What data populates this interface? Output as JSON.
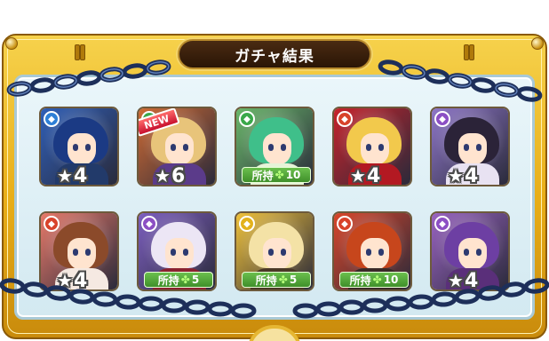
{
  "dialog": {
    "title": "ガチャ結果"
  },
  "colors": {
    "frame_gold": "#e8ad17",
    "panel_blue": "#d3e9f1",
    "title_plate": "#2a1506",
    "owned_green": "#4fa936",
    "chain_navy": "#1d2f5a"
  },
  "rows": [
    [
      {
        "element": "water",
        "element_icon": "water-icon",
        "rarity_value": "4",
        "is_new": false,
        "owned_label": "",
        "owned_count": "",
        "bg": "#2f5fb8",
        "hair": "#1b3a84",
        "outfit": "#223a6a"
      },
      {
        "element": "wood",
        "element_icon": "wood-icon",
        "rarity_value": "6",
        "is_new": true,
        "new_label": "NEW",
        "owned_label": "",
        "owned_count": "",
        "bg": "#cf6b34",
        "hair": "#e8c47a",
        "outfit": "#5b3b8a"
      },
      {
        "element": "wood",
        "element_icon": "wood-icon",
        "rarity_value": "",
        "is_new": false,
        "owned_label": "所持",
        "owned_count": "10",
        "bg": "#6ab86a",
        "hair": "#3fbf8a",
        "outfit": "#e6f3d8"
      },
      {
        "element": "fire",
        "element_icon": "fire-icon",
        "rarity_value": "4",
        "is_new": false,
        "owned_label": "",
        "owned_count": "",
        "bg": "#c8232b",
        "hair": "#f2c94c",
        "outfit": "#b31922"
      },
      {
        "element": "dark",
        "element_icon": "dark-icon",
        "rarity_value": "4",
        "is_new": false,
        "owned_label": "",
        "owned_count": "",
        "bg": "#8f77c9",
        "hair": "#2b2338",
        "outfit": "#e8e2f2"
      }
    ],
    [
      {
        "element": "fire",
        "element_icon": "fire-icon",
        "rarity_value": "4",
        "is_new": false,
        "owned_label": "",
        "owned_count": "",
        "bg": "#e87a6a",
        "hair": "#8b4a2a",
        "outfit": "#f5e9e2"
      },
      {
        "element": "dark",
        "element_icon": "dark-icon",
        "rarity_value": "",
        "is_new": false,
        "owned_label": "所持",
        "owned_count": "5",
        "bg": "#7d5fc0",
        "hair": "#ece6f5",
        "outfit": "#8a2230"
      },
      {
        "element": "light",
        "element_icon": "light-icon",
        "rarity_value": "",
        "is_new": false,
        "owned_label": "所持",
        "owned_count": "5",
        "bg": "#f0c23a",
        "hair": "#f4e2a6",
        "outfit": "#4a3826"
      },
      {
        "element": "fire",
        "element_icon": "fire-icon",
        "rarity_value": "",
        "is_new": false,
        "owned_label": "所持",
        "owned_count": "10",
        "bg": "#d9462a",
        "hair": "#c7461c",
        "outfit": "#3a2a28"
      },
      {
        "element": "dark",
        "element_icon": "dark-icon",
        "rarity_value": "4",
        "is_new": false,
        "owned_label": "",
        "owned_count": "",
        "bg": "#9a64c2",
        "hair": "#6d3fa3",
        "outfit": "#5a2f7a"
      }
    ]
  ]
}
